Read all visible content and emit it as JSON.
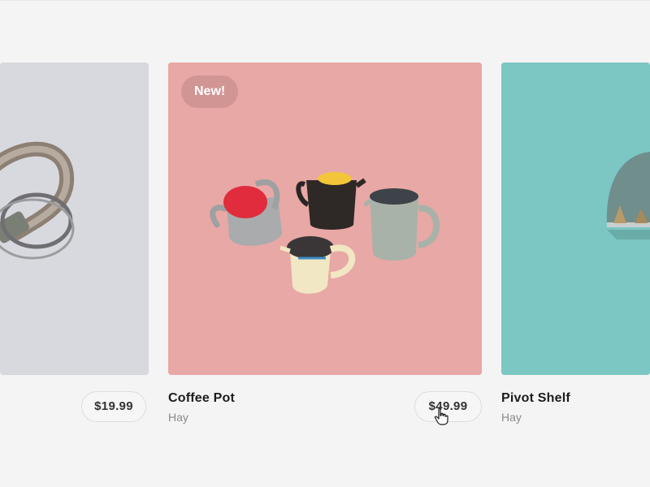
{
  "products": [
    {
      "title": "",
      "brand": "",
      "price": "$19.99",
      "badge": ""
    },
    {
      "title": "Coffee Pot",
      "brand": "Hay",
      "price": "$49.99",
      "badge": "New!"
    },
    {
      "title": "Pivot Shelf",
      "brand": "Hay",
      "price": "",
      "badge": ""
    }
  ],
  "colors": {
    "page_bg": "#f4f4f4",
    "card_left_bg": "#d8d9de",
    "card_center_bg": "#e8a6a6",
    "card_right_bg": "#79c6c3",
    "title_text": "#1c1c1c",
    "brand_text": "#8a8a8a"
  },
  "icons": [
    "hand-pointer-cursor-icon"
  ]
}
